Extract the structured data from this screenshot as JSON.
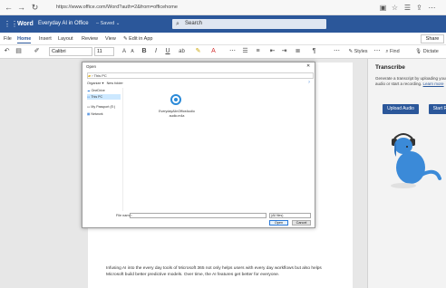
{
  "browser": {
    "url": "https://www.office.com/Word?auth=2&from=officehome"
  },
  "word": {
    "app_name": "Word",
    "doc_title": "Everyday AI in Office",
    "save_status": "Saved",
    "search_placeholder": "Search",
    "tabs": [
      "File",
      "Home",
      "Insert",
      "Layout",
      "Review",
      "View"
    ],
    "edit_in_app": "Edit in App",
    "share_label": "Share",
    "font_name": "Calibri",
    "font_size": "11",
    "styles_label": "Styles",
    "find_label": "Find",
    "dictate_label": "Dictate"
  },
  "document": {
    "body_text": "Infusing AI into the every day tools of Microsoft 365 not only helps users with every day workflows but also helps Microsoft build better predictive models. Over time, the AI features get better for everyone."
  },
  "transcribe": {
    "title": "Transcribe",
    "description": "Generate a transcript by uploading your audio or start a recording.",
    "learn_more": "Learn more",
    "upload_label": "Upload Audio",
    "start_label": "Start Rec"
  },
  "dialog": {
    "title": "Open",
    "address": "This PC",
    "organize": "Organize",
    "new_folder": "New folder",
    "sidebar": [
      "OneDrive",
      "This PC",
      "My Passport (E:)",
      "Network"
    ],
    "selected_index": 1,
    "file_name": "EverydayAIinOfficeAudio",
    "file_ext": "audio.m4a",
    "filename_label": "File name:",
    "filetype_value": "(All files)",
    "open_label": "Open",
    "cancel_label": "Cancel"
  },
  "colors": {
    "word_blue": "#2b579a",
    "pane_bg": "#f3f3f3",
    "cortana_blue": "#2b8ad8"
  }
}
